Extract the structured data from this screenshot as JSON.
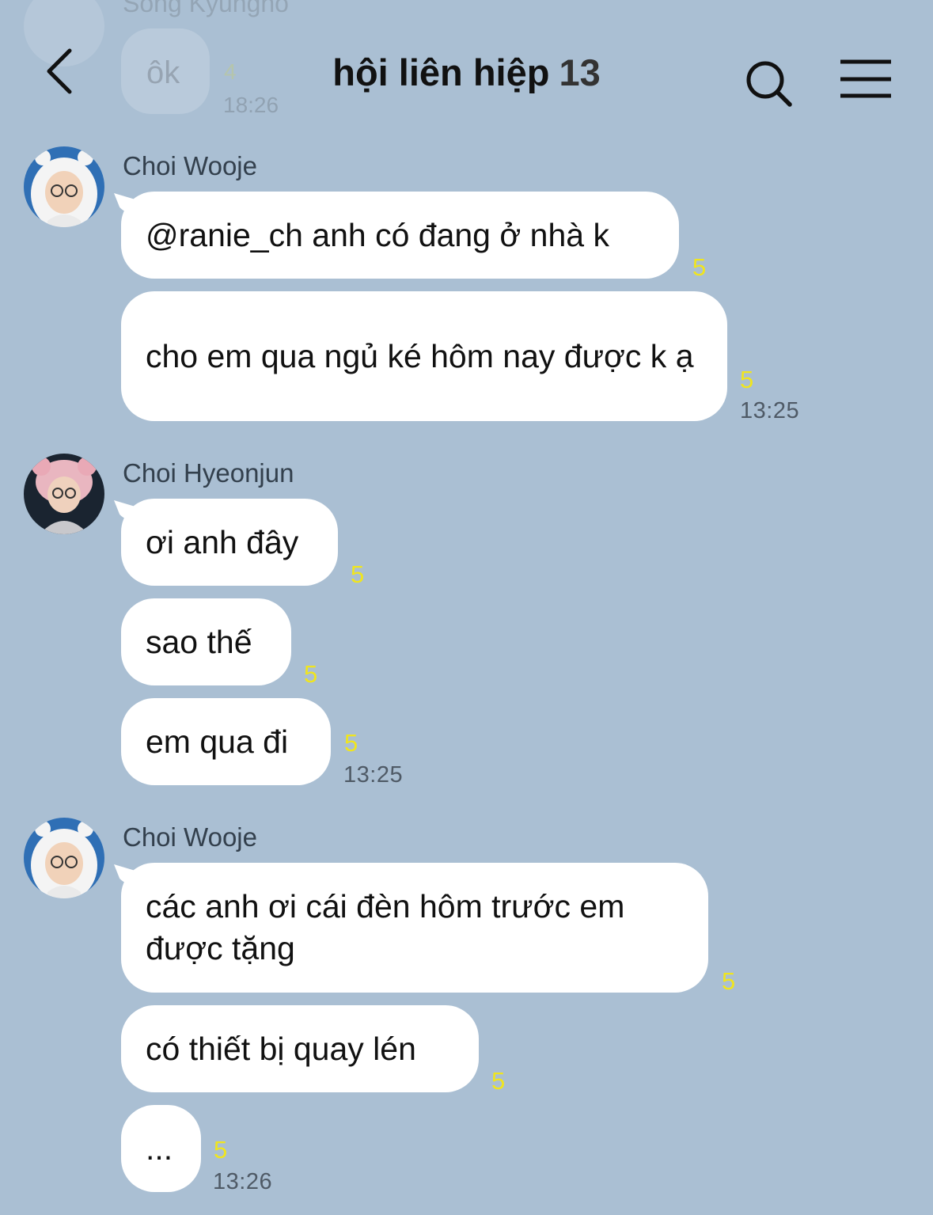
{
  "header": {
    "title": "hội liên hiệp",
    "member_count": "13"
  },
  "faded_prev": {
    "sender": "Song Kyungho",
    "text": "ôk",
    "read": "4",
    "time": "18:26"
  },
  "groups": [
    {
      "sender": "Choi Wooje",
      "messages": [
        {
          "text": "@ranie_ch anh có đang ở nhà k",
          "read": "5"
        },
        {
          "text": "cho em qua ngủ ké hôm nay được k ạ",
          "read": "5",
          "time": "13:25"
        }
      ]
    },
    {
      "sender": "Choi Hyeonjun",
      "messages": [
        {
          "text": "ơi anh đây",
          "read": "5"
        },
        {
          "text": "sao thế",
          "read": "5"
        },
        {
          "text": "em qua đi",
          "read": "5",
          "time": "13:25"
        }
      ]
    },
    {
      "sender": "Choi Wooje",
      "messages": [
        {
          "text": "các anh ơi cái đèn hôm trước em được tặng",
          "read": "5"
        },
        {
          "text": "có thiết bị quay lén",
          "read": "5"
        },
        {
          "text": "...",
          "read": "5",
          "time": "13:26"
        }
      ]
    }
  ],
  "colors": {
    "background": "#aabfd3",
    "bubble": "#ffffff",
    "read_count": "#f0e51e"
  },
  "icons": [
    "chevron-left-icon",
    "search-icon",
    "menu-icon",
    "avatar-wooje",
    "avatar-hyeonjun"
  ]
}
